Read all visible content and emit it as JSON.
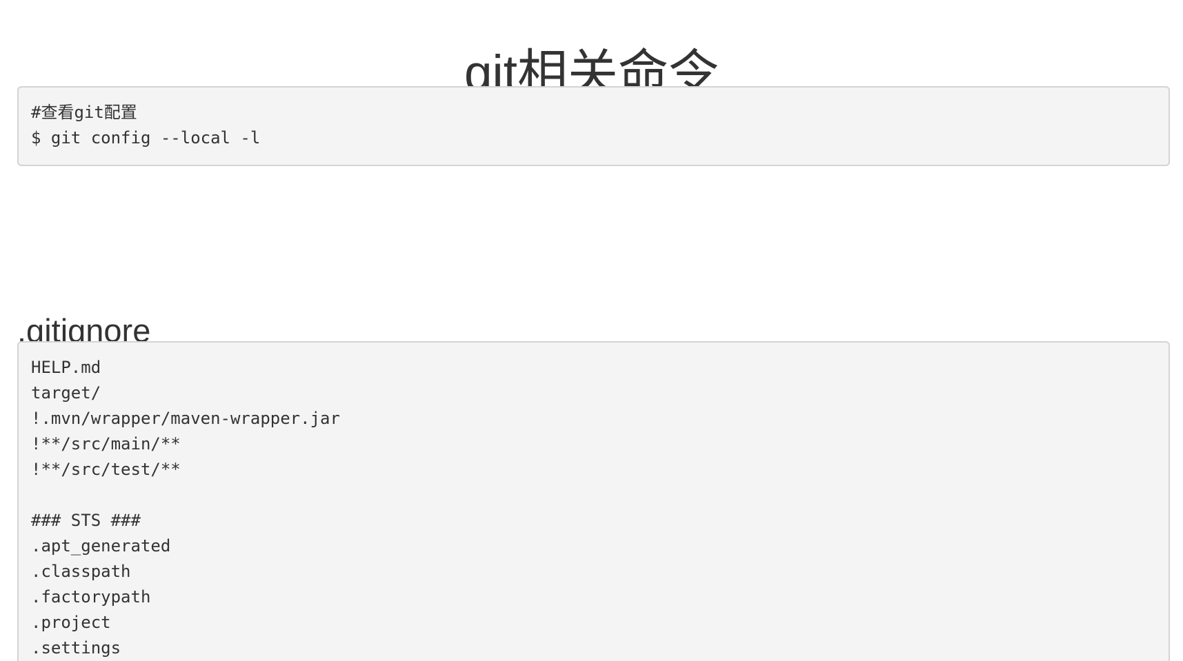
{
  "page_title": "git相关命令",
  "config_block": {
    "lines": [
      "#查看git配置",
      "$ git config --local -l"
    ]
  },
  "gitignore": {
    "heading": ".gitignore",
    "lines": [
      "HELP.md",
      "target/",
      "!.mvn/wrapper/maven-wrapper.jar",
      "!**/src/main/**",
      "!**/src/test/**",
      "",
      "### STS ###",
      ".apt_generated",
      ".classpath",
      ".factorypath",
      ".project",
      ".settings"
    ]
  }
}
